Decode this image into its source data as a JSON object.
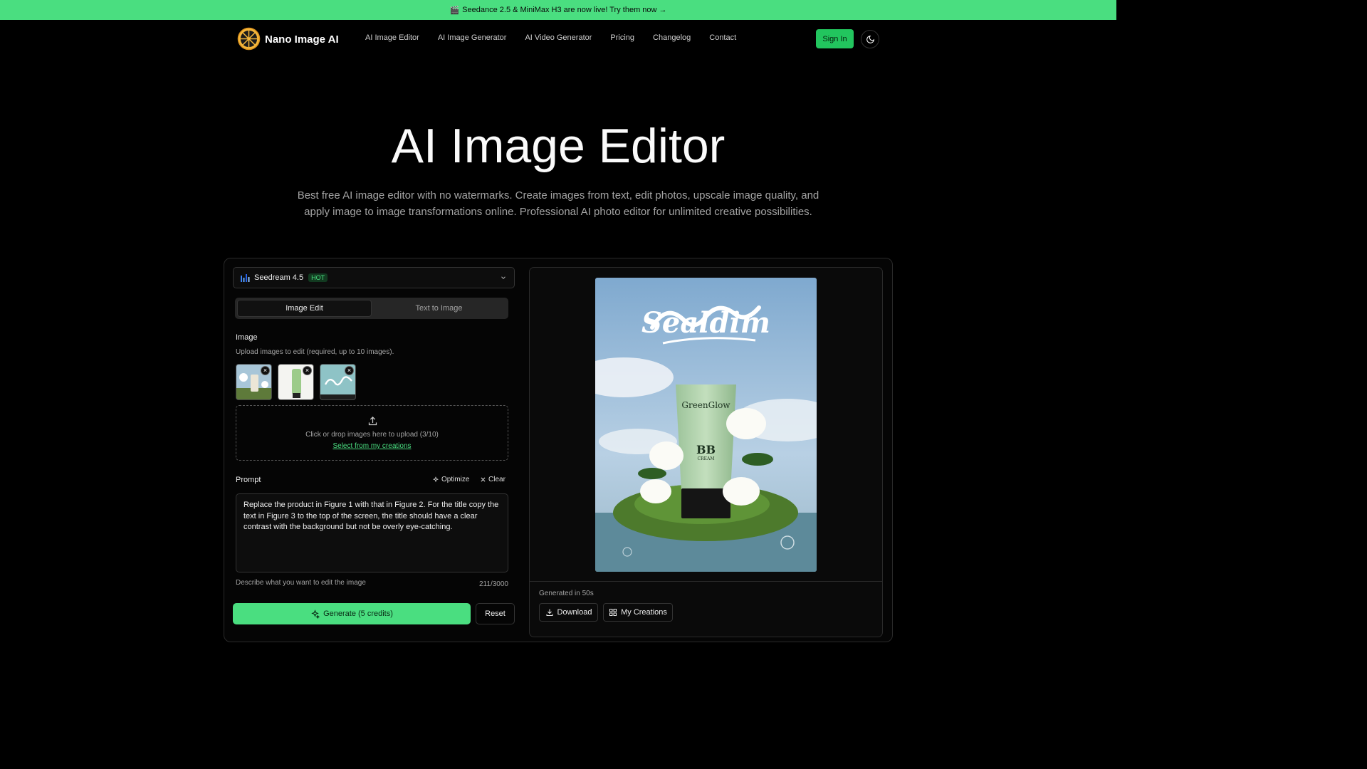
{
  "banner": {
    "icon": "clapperboard-icon",
    "text": "Seedance 2.5 & MiniMax H3 are now live! Try them now →"
  },
  "nav": {
    "brand": "Nano Image AI",
    "links": [
      "AI Image Editor",
      "AI Image Generator",
      "AI Video Generator",
      "Pricing",
      "Changelog",
      "Contact"
    ],
    "sign_in": "Sign In",
    "theme_icon": "moon-icon"
  },
  "hero": {
    "title": "AI Image Editor",
    "subtitle": "Best free AI image editor with no watermarks. Create images from text, edit photos, upscale image quality, and apply image to image transformations online. Professional AI photo editor for unlimited creative possibilities."
  },
  "editor": {
    "model": {
      "name": "Seedream 4.5",
      "badge": "HOT"
    },
    "tabs": [
      {
        "label": "Image Edit",
        "active": true
      },
      {
        "label": "Text to Image",
        "active": false
      }
    ],
    "image_label": "Image",
    "image_hint": "Upload images to edit (required, up to 10 images).",
    "dropzone": {
      "text": "Click or drop images here to upload (3/10)",
      "link": "Select from my creations"
    },
    "prompt_label": "Prompt",
    "optimize": "Optimize",
    "clear": "Clear",
    "prompt_value": "Replace the product in Figure 1 with that in Figure 2. For the title copy the text in Figure 3 to the top of the screen, the title should have a clear contrast with the background but not be overly eye-catching.",
    "prompt_hint": "Describe what you want to edit the image",
    "prompt_count": "211/3000",
    "generate": "Generate (5 credits)",
    "reset": "Reset"
  },
  "result": {
    "logo_text": "Sealdim",
    "product_brand": "GreenGlow",
    "product_name": "BB",
    "product_sub": "CREAM",
    "generated_in": "Generated in 50s",
    "download": "Download",
    "my_creations": "My Creations"
  },
  "colors": {
    "accent": "#4ade80",
    "background": "#000000"
  }
}
